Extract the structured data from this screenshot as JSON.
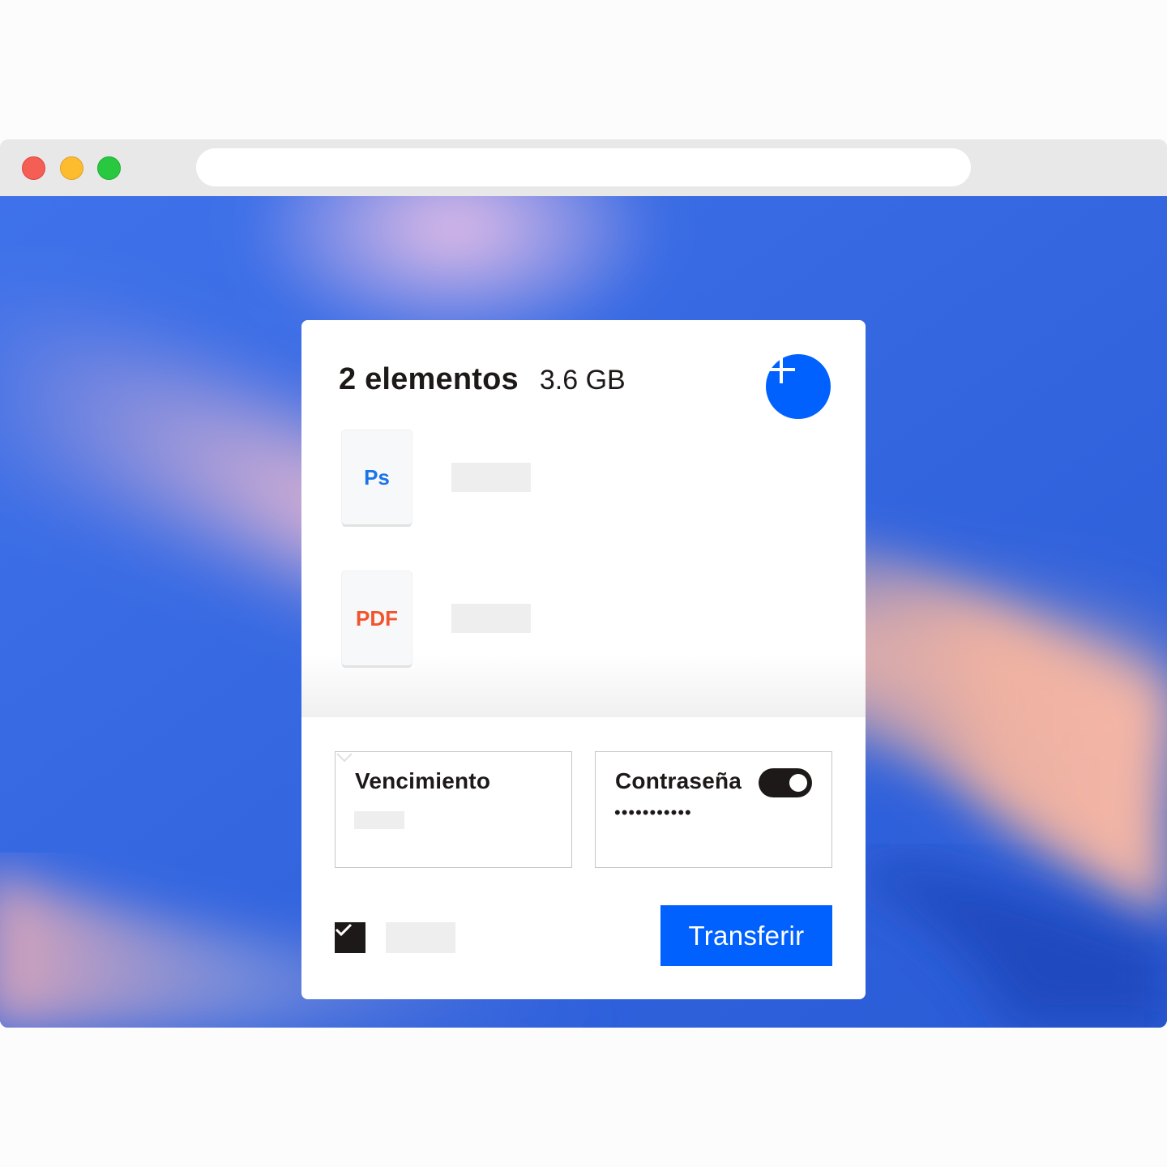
{
  "browser": {
    "window_controls": [
      "close",
      "minimize",
      "maximize"
    ],
    "address_bar_text": ""
  },
  "colors": {
    "accent": "#0061fe",
    "text": "#1e1919",
    "ps": "#1a73e8",
    "pdf": "#f2542d"
  },
  "transfer": {
    "item_count": "2 elementos",
    "total_size": "3.6 GB",
    "add_icon": "plus-icon",
    "files": [
      {
        "type_label": "Ps",
        "name": ""
      },
      {
        "type_label": "PDF",
        "name": ""
      }
    ],
    "expiration": {
      "label": "Vencimiento",
      "value": ""
    },
    "password": {
      "label": "Contraseña",
      "enabled": true,
      "value": "•••••••••••"
    },
    "checkbox": {
      "checked": true,
      "label": ""
    },
    "submit_label": "Transferir"
  }
}
